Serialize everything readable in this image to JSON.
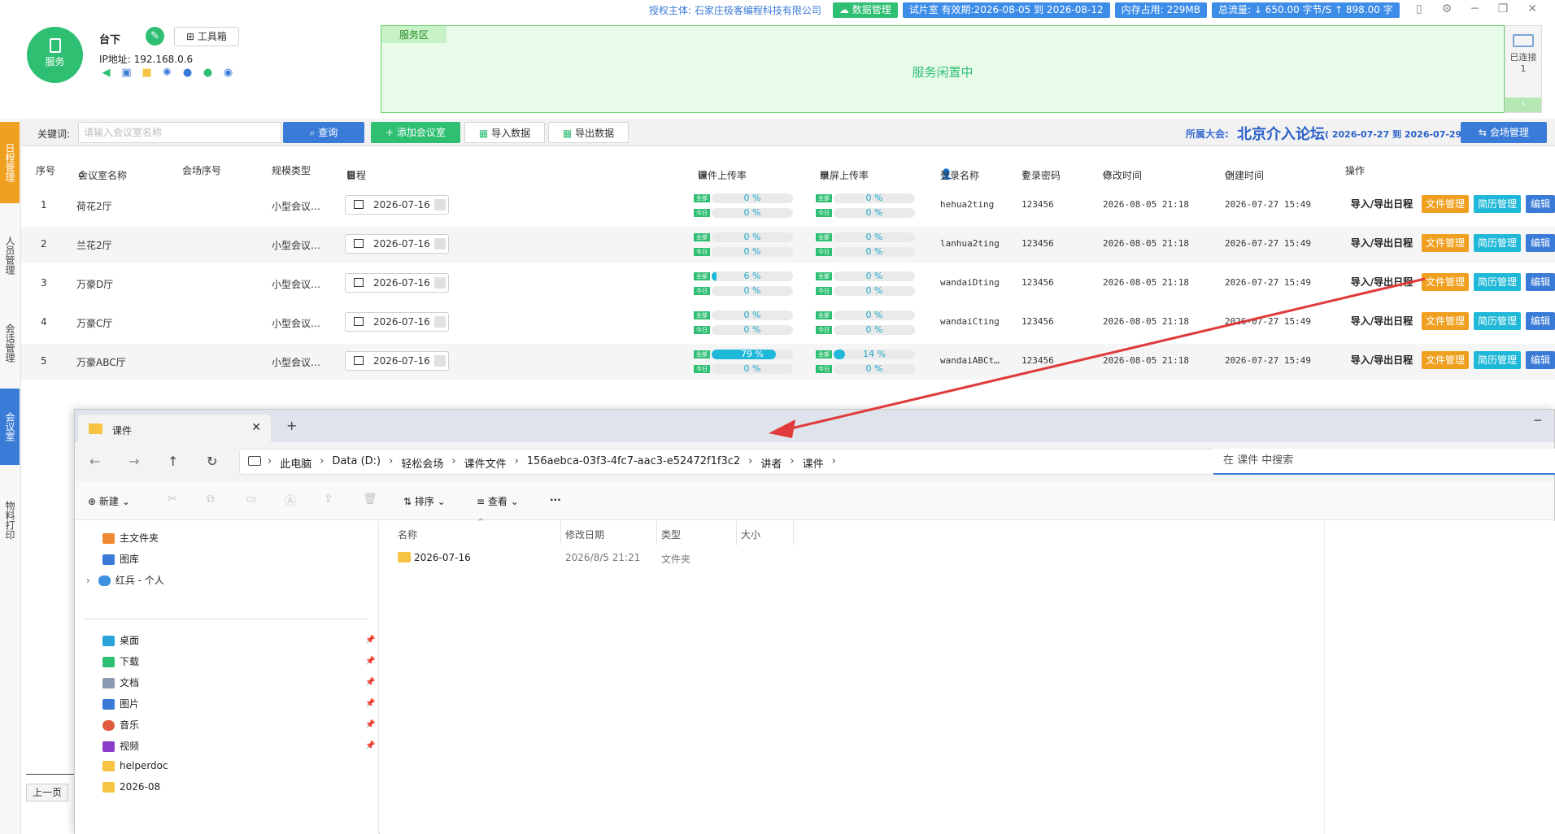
{
  "header": {
    "logo_label": "服务",
    "station_name": "台下",
    "toolbox_label": "工具箱",
    "ip_label": "IP地址: 192.168.0.6",
    "auth_text": "授权主体: 石家庄极客编程科技有限公司",
    "data_mgmt_label": "数据管理",
    "trial_text": "试片室 有效期:2026-08-05 到 2026-08-12",
    "memory_text": "内存占用: 229MB",
    "traffic_text": "总流量: ↓ 650.00 字节/S  ↑ 898.00 字",
    "service_zone_title": "服务区",
    "service_status": "服务闲置中",
    "connected_label": "已连接",
    "connected_count": "1"
  },
  "sidebar": {
    "items": [
      "日程管理",
      "人员管理",
      "会话管理",
      "会议室",
      "物料打印"
    ]
  },
  "search": {
    "keyword_label": "关键词:",
    "placeholder": "请输入会议室名称",
    "query_label": "查询",
    "add_label": "添加会议室",
    "import_label": "导入数据",
    "export_label": "导出数据",
    "conference_label": "所属大会:",
    "conference_name": "北京介入论坛",
    "conference_dates": "( 2026-07-27 到 2026-07-29 )",
    "venue_mgmt_label": "会场管理"
  },
  "table": {
    "headers": [
      "序号",
      "会议室名称",
      "会场序号",
      "规模类型",
      "日程",
      "课件上传率",
      "录屏上传率",
      "登录名称",
      "登录密码",
      "修改时间",
      "创建时间",
      "操作"
    ],
    "badge_all": "全部",
    "badge_today": "今日",
    "actions": [
      "导入/导出日程",
      "文件管理",
      "简历管理",
      "编辑"
    ],
    "rows": [
      {
        "no": "1",
        "name": "荷花2厅",
        "scale": "小型会议…",
        "date": "2026-07-16",
        "courseware_all": 0,
        "courseware_today": 0,
        "screen_all": 0,
        "screen_today": 0,
        "courseware_all_text": "0 %",
        "courseware_today_text": "0 %",
        "screen_all_text": "0 %",
        "screen_today_text": "0 %",
        "login": "hehua2ting",
        "password": "123456",
        "modified": "2026-08-05 21:18",
        "created": "2026-07-27 15:49"
      },
      {
        "no": "2",
        "name": "兰花2厅",
        "scale": "小型会议…",
        "date": "2026-07-16",
        "courseware_all": 0,
        "courseware_today": 0,
        "screen_all": 0,
        "screen_today": 0,
        "courseware_all_text": "0 %",
        "courseware_today_text": "0 %",
        "screen_all_text": "0 %",
        "screen_today_text": "0 %",
        "login": "lanhua2ting",
        "password": "123456",
        "modified": "2026-08-05 21:18",
        "created": "2026-07-27 15:49"
      },
      {
        "no": "3",
        "name": "万豪D厅",
        "scale": "小型会议…",
        "date": "2026-07-16",
        "courseware_all": 6,
        "courseware_today": 0,
        "screen_all": 0,
        "screen_today": 0,
        "courseware_all_text": "6 %",
        "courseware_today_text": "0 %",
        "screen_all_text": "0 %",
        "screen_today_text": "0 %",
        "login": "wandaiDting",
        "password": "123456",
        "modified": "2026-08-05 21:18",
        "created": "2026-07-27 15:49"
      },
      {
        "no": "4",
        "name": "万豪C厅",
        "scale": "小型会议…",
        "date": "2026-07-16",
        "courseware_all": 0,
        "courseware_today": 0,
        "screen_all": 0,
        "screen_today": 0,
        "courseware_all_text": "0 %",
        "courseware_today_text": "0 %",
        "screen_all_text": "0 %",
        "screen_today_text": "0 %",
        "login": "wandaiCting",
        "password": "123456",
        "modified": "2026-08-05 21:18",
        "created": "2026-07-27 15:49"
      },
      {
        "no": "5",
        "name": "万豪ABC厅",
        "scale": "小型会议…",
        "date": "2026-07-16",
        "courseware_all": 79,
        "courseware_today": 0,
        "screen_all": 14,
        "screen_today": 0,
        "courseware_all_text": "79 %",
        "courseware_today_text": "0 %",
        "screen_all_text": "14 %",
        "screen_today_text": "0 %",
        "login": "wandaiABCt…",
        "password": "123456",
        "modified": "2026-08-05 21:18",
        "created": "2026-07-27 15:49"
      }
    ]
  },
  "pager": {
    "prev_label": "上一页"
  },
  "explorer": {
    "tab_title": "课件",
    "breadcrumbs": [
      "此电脑",
      "Data (D:)",
      "轻松会场",
      "课件文件",
      "156aebca-03f3-4fc7-aac3-e52472f1f3c2",
      "讲者",
      "课件"
    ],
    "search_placeholder": "在 课件 中搜索",
    "commands": {
      "new": "新建",
      "sort": "排序",
      "view": "查看",
      "more": "···"
    },
    "nav_top": [
      "主文件夹",
      "图库",
      "红兵 - 个人"
    ],
    "nav_pinned": [
      "桌面",
      "下载",
      "文档",
      "图片",
      "音乐",
      "视频"
    ],
    "nav_folders": [
      "helperdoc",
      "2026-08"
    ],
    "columns": [
      "名称",
      "修改日期",
      "类型",
      "大小"
    ],
    "files": [
      {
        "name": "2026-07-16",
        "modified": "2026/8/5 21:21",
        "type": "文件夹",
        "size": ""
      }
    ]
  },
  "colors": {
    "brand_green": "#2ebf73",
    "brand_blue": "#3b7bd8",
    "accent_orange": "#f0a020",
    "accent_cyan": "#20b8d8",
    "annotation_red": "#e03a3a"
  }
}
